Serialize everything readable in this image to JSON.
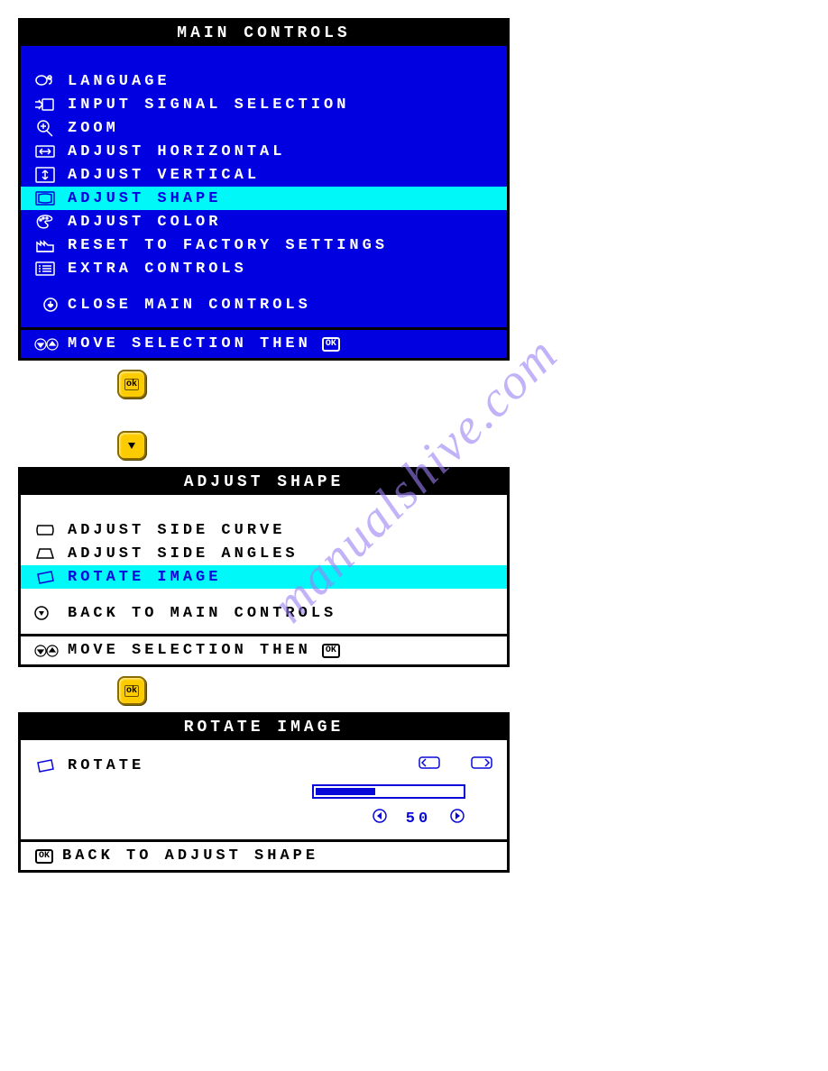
{
  "watermark": "manualshive.com",
  "panel1": {
    "title": "MAIN CONTROLS",
    "items": [
      {
        "label": "LANGUAGE",
        "icon": "language"
      },
      {
        "label": "INPUT SIGNAL SELECTION",
        "icon": "input"
      },
      {
        "label": "ZOOM",
        "icon": "zoom"
      },
      {
        "label": "ADJUST HORIZONTAL",
        "icon": "horiz"
      },
      {
        "label": "ADJUST VERTICAL",
        "icon": "vert"
      },
      {
        "label": "ADJUST SHAPE",
        "icon": "shape",
        "selected": true
      },
      {
        "label": "ADJUST COLOR",
        "icon": "palette"
      },
      {
        "label": "RESET TO FACTORY SETTINGS",
        "icon": "factory"
      },
      {
        "label": "EXTRA CONTROLS",
        "icon": "list"
      }
    ],
    "close": "CLOSE MAIN CONTROLS",
    "footer": "MOVE SELECTION THEN"
  },
  "panel2": {
    "title": "ADJUST SHAPE",
    "items": [
      {
        "label": "ADJUST SIDE CURVE",
        "icon": "sidecurve"
      },
      {
        "label": "ADJUST SIDE ANGLES",
        "icon": "sideangle"
      },
      {
        "label": "ROTATE IMAGE",
        "icon": "rotate",
        "selected": true
      }
    ],
    "back": "BACK TO MAIN CONTROLS",
    "footer": "MOVE SELECTION THEN"
  },
  "panel3": {
    "title": "ROTATE IMAGE",
    "item_label": "ROTATE",
    "value": "50",
    "percent": 40,
    "footer": "BACK TO ADJUST SHAPE"
  }
}
